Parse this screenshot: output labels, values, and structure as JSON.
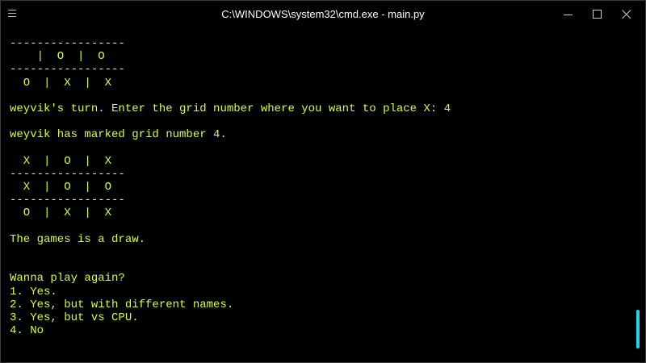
{
  "window": {
    "title": "C:\\WINDOWS\\system32\\cmd.exe - main.py"
  },
  "icons": {
    "menu": "hamburger-menu-icon",
    "minimize": "minimize-icon",
    "maximize": "maximize-icon",
    "close": "close-icon"
  },
  "colors": {
    "console_text": "#d6ff2e",
    "background": "#000000",
    "scrollbar_thumb": "#1ad5e8"
  },
  "console": {
    "lines": [
      "-----------------",
      "    |  O  |  O",
      "-----------------",
      "  O  |  X  |  X",
      "",
      "weyvik's turn. Enter the grid number where you want to place X: 4",
      "",
      "weyvik has marked grid number 4.",
      "",
      "  X  |  O  |  X",
      "-----------------",
      "  X  |  O  |  O",
      "-----------------",
      "  O  |  X  |  X",
      "",
      "The games is a draw.",
      "",
      "",
      "Wanna play again?",
      "1. Yes.",
      "2. Yes, but with different names.",
      "3. Yes, but vs CPU.",
      "4. No",
      ""
    ],
    "cursor": "_"
  }
}
